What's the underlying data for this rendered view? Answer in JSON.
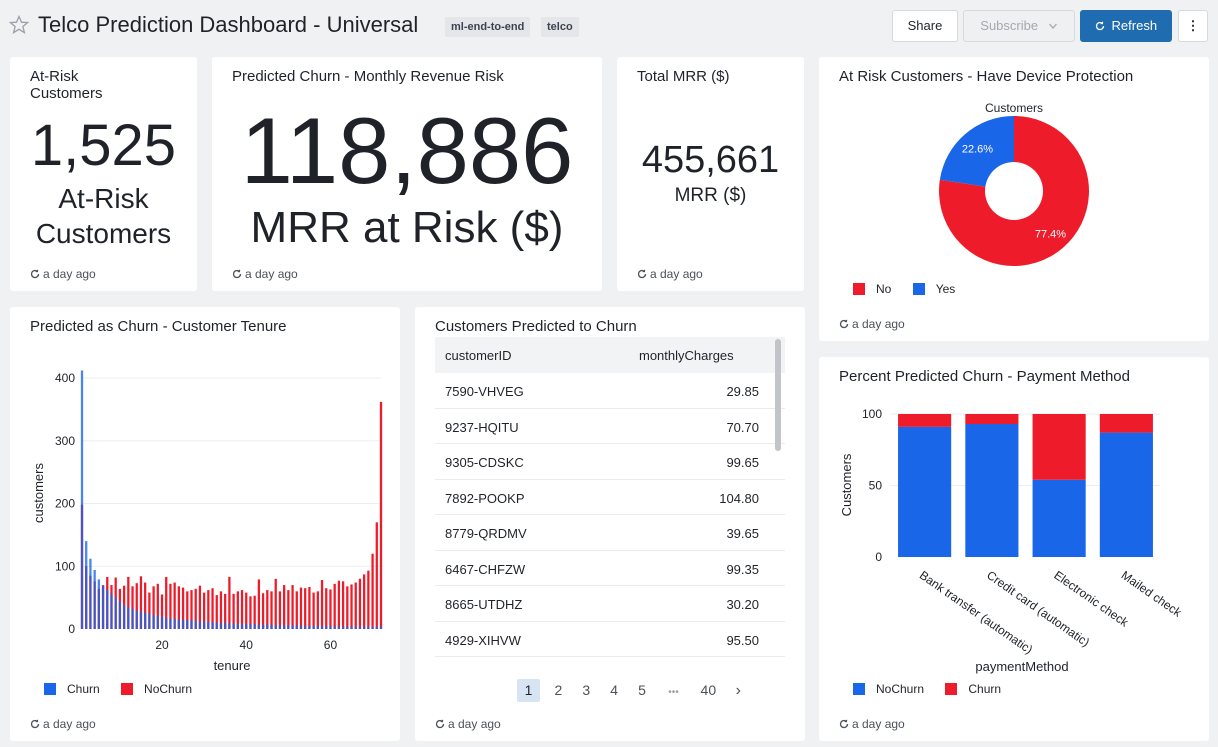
{
  "header": {
    "title": "Telco Prediction Dashboard - Universal",
    "tags": [
      "ml-end-to-end",
      "telco"
    ],
    "share_label": "Share",
    "subscribe_label": "Subscribe",
    "refresh_label": "Refresh",
    "more_label": "⋮"
  },
  "updated_label": "a day ago",
  "colors": {
    "blue": "#1a66e8",
    "red": "#ee1c2a",
    "accent": "#1f6cb0"
  },
  "cards": {
    "at_risk": {
      "title": "At-Risk Customers",
      "value": "1,525",
      "subtitle1": "At-Risk",
      "subtitle2": "Customers"
    },
    "churn_rev": {
      "title": "Predicted Churn - Monthly Revenue Risk",
      "value": "118,886",
      "subtitle": "MRR at Risk ($)"
    },
    "total_mrr": {
      "title": "Total MRR ($)",
      "value": "455,661",
      "subtitle": "MRR ($)"
    },
    "device": {
      "title": "At Risk Customers - Have Device Protection",
      "chart_data": {
        "type": "pie",
        "title": "Customers",
        "categories": [
          "No",
          "Yes"
        ],
        "values": [
          77.4,
          22.6
        ],
        "labels": [
          "77.4%",
          "22.6%"
        ],
        "colors": [
          "#ee1c2a",
          "#1a66e8"
        ]
      }
    },
    "tenure": {
      "title": "Predicted as Churn - Customer Tenure",
      "chart_data": {
        "type": "bar",
        "xlabel": "tenure",
        "ylabel": "customers",
        "ylim": [
          0,
          400
        ],
        "yticks": [
          0,
          100,
          200,
          300,
          400
        ],
        "xticks": [
          20,
          40,
          60
        ],
        "x": [
          1,
          2,
          3,
          4,
          5,
          6,
          7,
          8,
          9,
          10,
          11,
          12,
          13,
          14,
          15,
          16,
          17,
          18,
          19,
          20,
          21,
          22,
          23,
          24,
          25,
          26,
          27,
          28,
          29,
          30,
          31,
          32,
          33,
          34,
          35,
          36,
          37,
          38,
          39,
          40,
          41,
          42,
          43,
          44,
          45,
          46,
          47,
          48,
          49,
          50,
          51,
          52,
          53,
          54,
          55,
          56,
          57,
          58,
          59,
          60,
          61,
          62,
          63,
          64,
          65,
          66,
          67,
          68,
          69,
          70,
          71,
          72
        ],
        "series": [
          {
            "name": "Churn",
            "color": "#1a66e8",
            "values": [
              412,
              140,
              112,
              94,
              79,
              69,
              62,
              56,
              50,
              44,
              38,
              35,
              32,
              29,
              28,
              26,
              24,
              22,
              21,
              20,
              18,
              17,
              16,
              15,
              15,
              14,
              14,
              13,
              12,
              12,
              11,
              11,
              10,
              10,
              10,
              9,
              9,
              8,
              8,
              8,
              8,
              8,
              7,
              7,
              7,
              7,
              6,
              6,
              6,
              6,
              6,
              6,
              5,
              5,
              5,
              5,
              5,
              5,
              5,
              5,
              4,
              4,
              4,
              4,
              4,
              4,
              4,
              4,
              4,
              4,
              4,
              4
            ]
          },
          {
            "name": "NoChurn",
            "color": "#ee1c2a",
            "values": [
              198,
              100,
              85,
              76,
              64,
              70,
              83,
              70,
              82,
              64,
              69,
              83,
              68,
              73,
              84,
              74,
              58,
              68,
              72,
              55,
              83,
              72,
              74,
              68,
              66,
              60,
              62,
              64,
              69,
              58,
              62,
              65,
              54,
              60,
              56,
              83,
              56,
              60,
              62,
              58,
              52,
              53,
              79,
              57,
              62,
              60,
              80,
              60,
              70,
              62,
              70,
              60,
              66,
              65,
              67,
              58,
              60,
              78,
              65,
              63,
              72,
              77,
              76,
              68,
              71,
              74,
              80,
              87,
              93,
              120,
              170,
              362
            ]
          }
        ]
      }
    },
    "table": {
      "title": "Customers Predicted to Churn",
      "columns": [
        "customerID",
        "monthlyCharges"
      ],
      "rows": [
        [
          "7590-VHVEG",
          "29.85"
        ],
        [
          "9237-HQITU",
          "70.70"
        ],
        [
          "9305-CDSKC",
          "99.65"
        ],
        [
          "7892-POOKP",
          "104.80"
        ],
        [
          "8779-QRDMV",
          "39.65"
        ],
        [
          "6467-CHFZW",
          "99.35"
        ],
        [
          "8665-UTDHZ",
          "30.20"
        ],
        [
          "4929-XIHVW",
          "95.50"
        ]
      ],
      "pagination": {
        "current": "1",
        "pages": [
          "1",
          "2",
          "3",
          "4",
          "5"
        ],
        "ellipsis": "•••",
        "last": "40",
        "next": "›"
      }
    },
    "payment": {
      "title": "Percent Predicted Churn - Payment Method",
      "chart_data": {
        "type": "bar",
        "stacked": true,
        "xlabel": "paymentMethod",
        "ylabel": "Customers",
        "ylim": [
          0,
          100
        ],
        "yticks": [
          0,
          50,
          100
        ],
        "categories": [
          "Bank transfer (automatic)",
          "Credit card (automatic)",
          "Electronic check",
          "Mailed check"
        ],
        "series": [
          {
            "name": "NoChurn",
            "color": "#1a66e8",
            "values": [
              91,
              93,
              54,
              87
            ]
          },
          {
            "name": "Churn",
            "color": "#ee1c2a",
            "values": [
              9,
              7,
              46,
              13
            ]
          }
        ]
      }
    }
  }
}
